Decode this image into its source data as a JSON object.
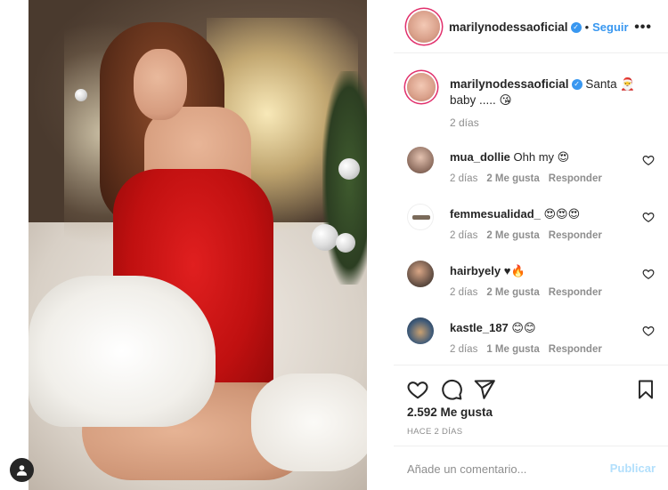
{
  "post": {
    "author": "marilynodessaoficial",
    "follow_label": "Seguir",
    "separator": "•",
    "more_icon": "more-horizontal-icon"
  },
  "caption": {
    "author": "marilynodessaoficial",
    "text": "Santa 🎅 baby ..... 😘",
    "time": "2 días"
  },
  "comments": [
    {
      "user": "mua_dollie",
      "text": "Ohh my 😍",
      "time": "2 días",
      "likes": "2 Me gusta",
      "reply": "Responder"
    },
    {
      "user": "femmesualidad_",
      "text": "😍😍😍",
      "time": "2 días",
      "likes": "2 Me gusta",
      "reply": "Responder"
    },
    {
      "user": "hairbyely",
      "text": "♥🔥",
      "time": "2 días",
      "likes": "2 Me gusta",
      "reply": "Responder"
    },
    {
      "user": "kastle_187",
      "text": "😊😊",
      "time": "2 días",
      "likes": "1 Me gusta",
      "reply": "Responder"
    }
  ],
  "actions": {
    "likes": "2.592 Me gusta",
    "timestamp": "HACE 2 DÍAS"
  },
  "add_comment": {
    "placeholder": "Añade un comentario...",
    "publish_label": "Publicar"
  },
  "colors": {
    "link_blue": "#3897f0",
    "publish_disabled": "#b2dffc",
    "muted": "#8e8e8e",
    "text": "#262626"
  }
}
